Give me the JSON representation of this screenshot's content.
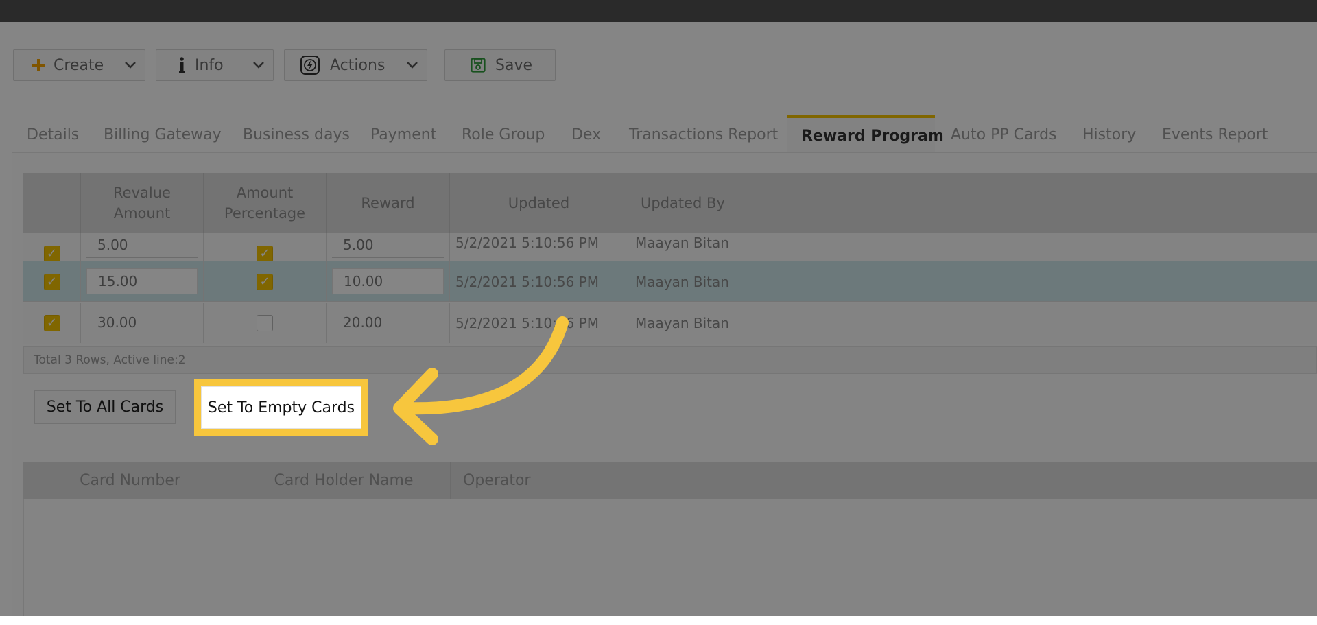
{
  "toolbar": {
    "create_label": "Create",
    "info_label": "Info",
    "actions_label": "Actions",
    "save_label": "Save"
  },
  "tabs": [
    {
      "label": "Details"
    },
    {
      "label": "Billing Gateway"
    },
    {
      "label": "Business days"
    },
    {
      "label": "Payment"
    },
    {
      "label": "Role Group"
    },
    {
      "label": "Dex"
    },
    {
      "label": "Transactions Report"
    },
    {
      "label": "Reward Program",
      "active": true
    },
    {
      "label": "Auto PP Cards"
    },
    {
      "label": "History"
    },
    {
      "label": "Events Report"
    }
  ],
  "reward_grid": {
    "headers": {
      "revalue_amount": "Revalue Amount",
      "amount_percentage": "Amount Percentage",
      "reward": "Reward",
      "updated": "Updated",
      "updated_by": "Updated By"
    },
    "rows": [
      {
        "checked": true,
        "revalue_amount": "5.00",
        "amount_percentage": true,
        "reward": "5.00",
        "updated": "5/2/2021 5:10:56 PM",
        "updated_by": "Maayan Bitan"
      },
      {
        "checked": true,
        "revalue_amount": "15.00",
        "amount_percentage": true,
        "reward": "10.00",
        "updated": "5/2/2021 5:10:56 PM",
        "updated_by": "Maayan Bitan",
        "active": true
      },
      {
        "checked": true,
        "revalue_amount": "30.00",
        "amount_percentage": false,
        "reward": "20.00",
        "updated": "5/2/2021 5:10:56 PM",
        "updated_by": "Maayan Bitan"
      }
    ],
    "footer": "Total 3 Rows, Active line:2"
  },
  "actions": {
    "set_all_label": "Set To All Cards",
    "set_empty_label": "Set To Empty Cards"
  },
  "cards_grid": {
    "headers": {
      "card_number": "Card Number",
      "card_holder_name": "Card Holder Name",
      "operator": "Operator"
    }
  },
  "colors": {
    "accent": "#f5c400",
    "highlight": "#f7c63d",
    "active_row": "#cfe8eb",
    "topbar": "#2a2a2a"
  },
  "icons": {
    "create": "plus-icon",
    "info": "info-icon",
    "actions": "bolt-icon",
    "save": "save-icon",
    "dropdown": "chevron-down-icon",
    "callout": "curved-arrow-icon"
  }
}
